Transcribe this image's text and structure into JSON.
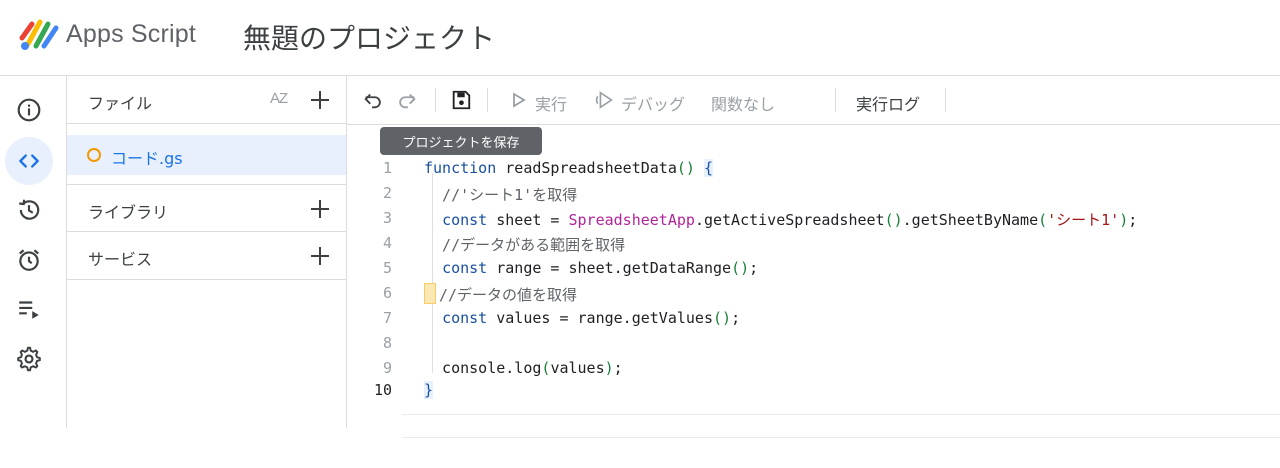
{
  "app": {
    "name": "Apps Script",
    "project_title": "無題のプロジェクト"
  },
  "rail": [
    {
      "icon": "info-icon"
    },
    {
      "icon": "code-icon",
      "active": true
    },
    {
      "icon": "history-icon"
    },
    {
      "icon": "alarm-trigger-icon"
    },
    {
      "icon": "executions-icon"
    },
    {
      "icon": "settings-gear-icon"
    }
  ],
  "files_panel": {
    "files_label": "ファイル",
    "sort_label": "AZ",
    "files": [
      {
        "name": "コード.gs"
      }
    ],
    "libraries_label": "ライブラリ",
    "services_label": "サービス"
  },
  "toolbar": {
    "run_label": "実行",
    "debug_label": "デバッグ",
    "function_select": "関数なし",
    "log_label": "実行ログ",
    "save_tooltip": "プロジェクトを保存"
  },
  "editor": {
    "lines": [
      {
        "n": "1",
        "text": "function readSpreadsheetData() {"
      },
      {
        "n": "2",
        "text": "  //'シート1'を取得"
      },
      {
        "n": "3",
        "text": "  const sheet = SpreadsheetApp.getActiveSpreadsheet().getSheetByName('シート1');"
      },
      {
        "n": "4",
        "text": "  //データがある範囲を取得"
      },
      {
        "n": "5",
        "text": "  const range = sheet.getDataRange();"
      },
      {
        "n": "6",
        "text": "//データの値を取得"
      },
      {
        "n": "7",
        "text": "  const values = range.getValues();"
      },
      {
        "n": "8",
        "text": ""
      },
      {
        "n": "9",
        "text": "  console.log(values);"
      },
      {
        "n": "10",
        "text": "}"
      }
    ],
    "current_line": "10"
  },
  "colors": {
    "accent": "#1a73e8",
    "active_bg": "#e8f0fe",
    "file_dot": "#f29900"
  }
}
